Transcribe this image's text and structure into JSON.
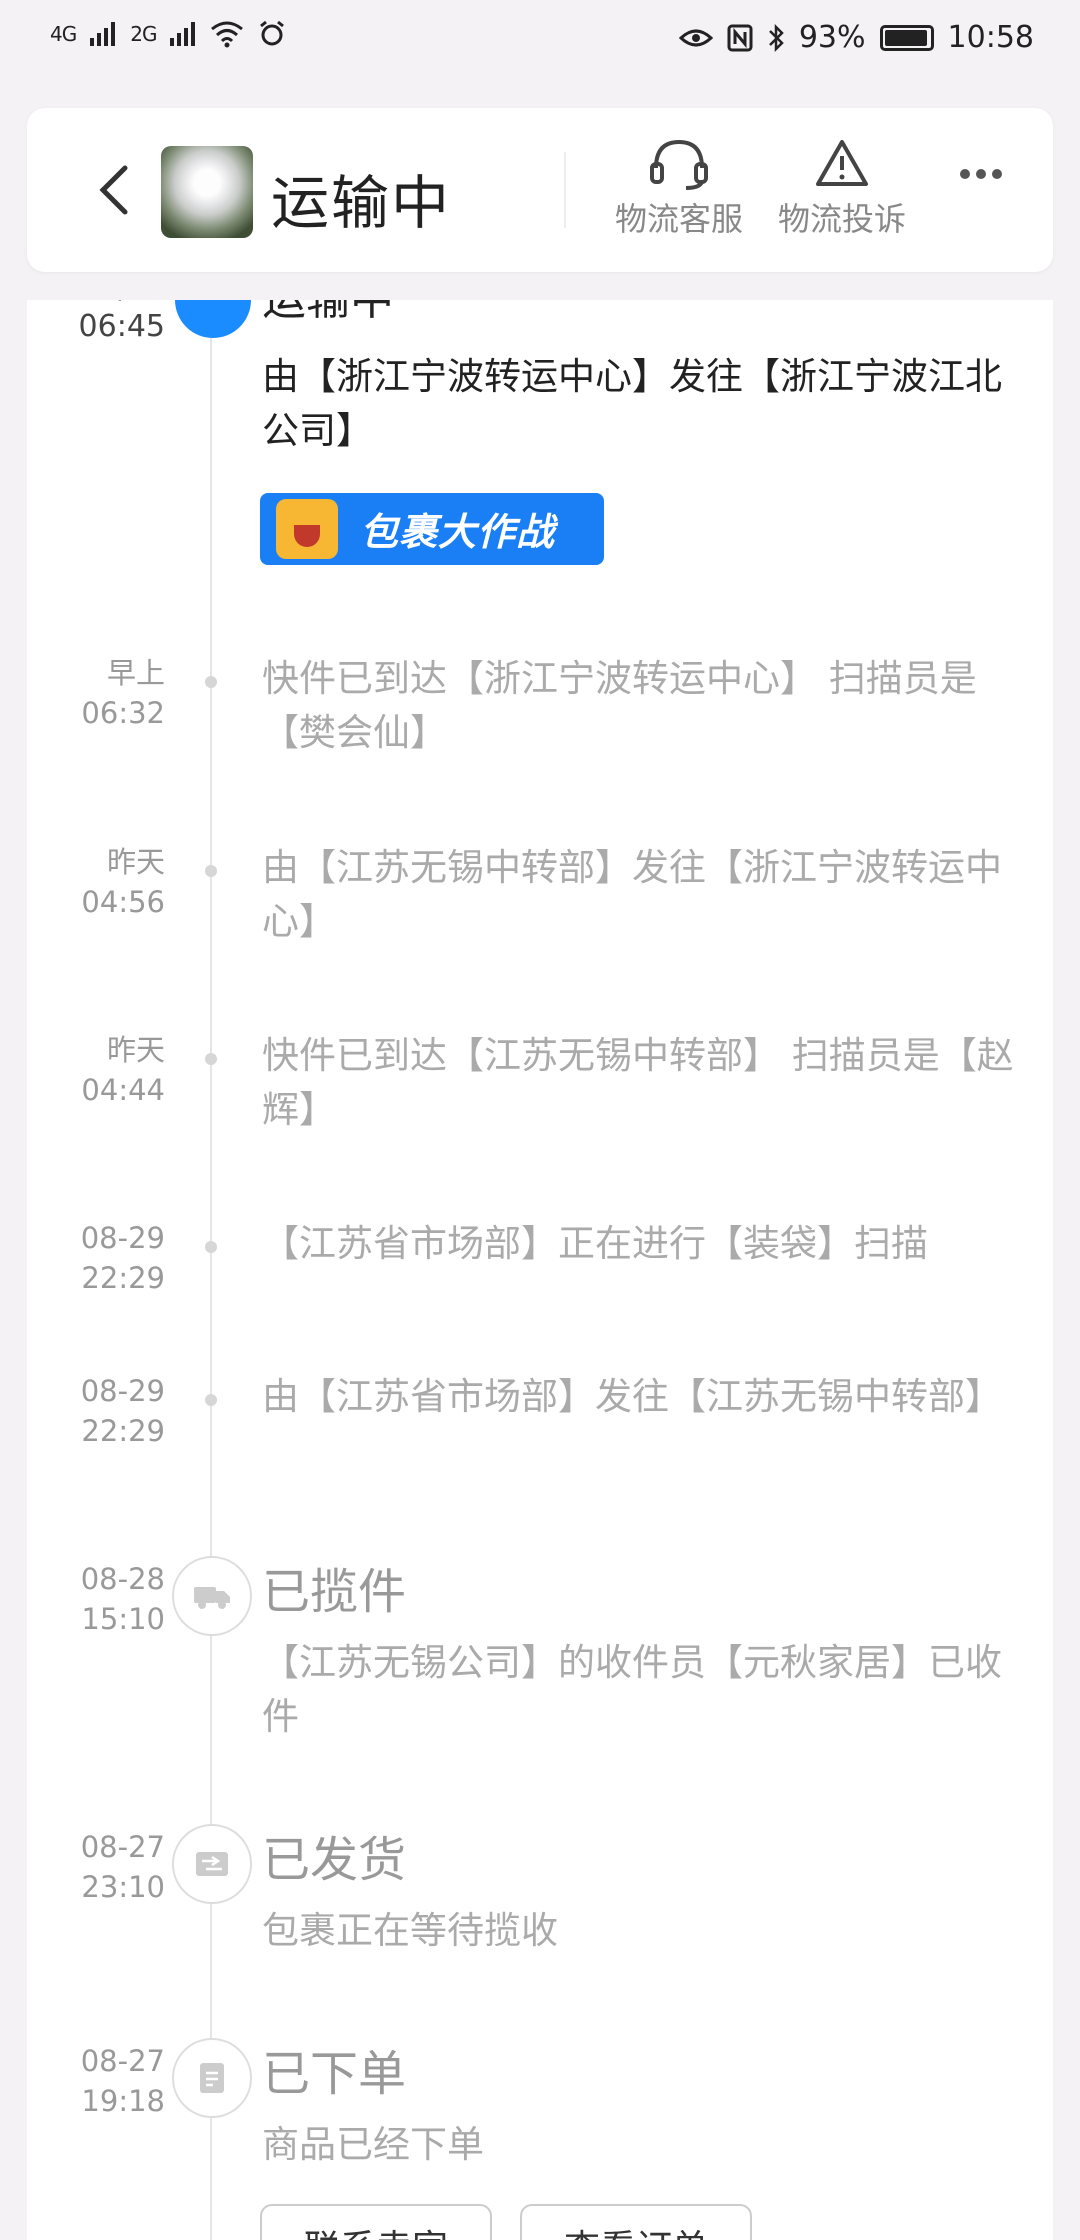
{
  "status_bar": {
    "net1": "4G",
    "net2": "2G",
    "battery": "93%",
    "time": "10:58"
  },
  "header": {
    "title": "运输中",
    "service_label": "物流客服",
    "complaint_label": "物流投诉"
  },
  "promo": {
    "label": "包裹大作战"
  },
  "timeline": [
    {
      "date": "早上",
      "time": "06:45",
      "status": "运输中",
      "text": "由【浙江宁波转运中心】发往【浙江宁波江北公司】"
    },
    {
      "date": "早上",
      "time": "06:32",
      "text": "快件已到达【浙江宁波转运中心】 扫描员是【樊会仙】"
    },
    {
      "date": "昨天",
      "time": "04:56",
      "text": "由【江苏无锡中转部】发往【浙江宁波转运中心】"
    },
    {
      "date": "昨天",
      "time": "04:44",
      "text": "快件已到达【江苏无锡中转部】 扫描员是【赵辉】"
    },
    {
      "date": "08-29",
      "time": "22:29",
      "text": "【江苏省市场部】正在进行【装袋】扫描"
    },
    {
      "date": "08-29",
      "time": "22:29",
      "text": "由【江苏省市场部】发往【江苏无锡中转部】"
    },
    {
      "date": "08-28",
      "time": "15:10",
      "status": "已揽件",
      "text": "【江苏无锡公司】的收件员【元秋家居】已收件"
    },
    {
      "date": "08-27",
      "time": "23:10",
      "status": "已发货",
      "text": "包裹正在等待揽收"
    },
    {
      "date": "08-27",
      "time": "19:18",
      "status": "已下单",
      "text": "商品已经下单"
    }
  ],
  "actions": {
    "contact_seller": "联系卖家",
    "view_order": "查看订单"
  }
}
